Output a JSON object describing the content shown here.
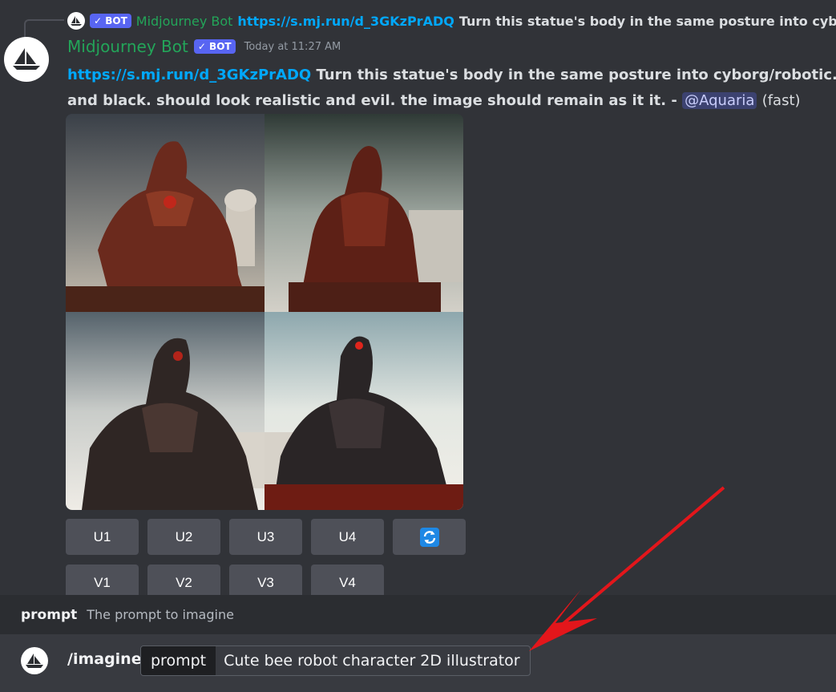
{
  "reply": {
    "name": "Midjourney Bot",
    "bot_tag": "✓ BOT",
    "link": "https://s.mj.run/d_3GKzPrADQ",
    "text": "Turn this statue's body in the same posture into cyborg/robotic. T"
  },
  "message": {
    "author": "Midjourney Bot",
    "bot_tag": "✓ BOT",
    "timestamp": "Today at 11:27 AM",
    "link": "https://s.mj.run/d_3GKzPrADQ",
    "line1_text": "Turn this statue's body in the same posture into cyborg/robotic. T",
    "line2_text": "and black. should look realistic and evil. the image should remain as it it. - ",
    "mention": "@Aquaria",
    "speed": "(fast)"
  },
  "buttons": {
    "upscale": [
      "U1",
      "U2",
      "U3",
      "U4"
    ],
    "variation": [
      "V1",
      "V2",
      "V3",
      "V4"
    ],
    "reroll_icon": "refresh-icon"
  },
  "prompt_hint": {
    "label": "prompt",
    "description": "The prompt to imagine"
  },
  "composer": {
    "command": "/imagine",
    "option_name": "prompt",
    "option_value": "Cute bee robot character 2D illustrator"
  },
  "colors": {
    "accent_blurple": "#5865f2",
    "bot_name_green": "#23a559",
    "link_blue": "#00a8fc",
    "annotation_arrow": "#e3161b"
  }
}
